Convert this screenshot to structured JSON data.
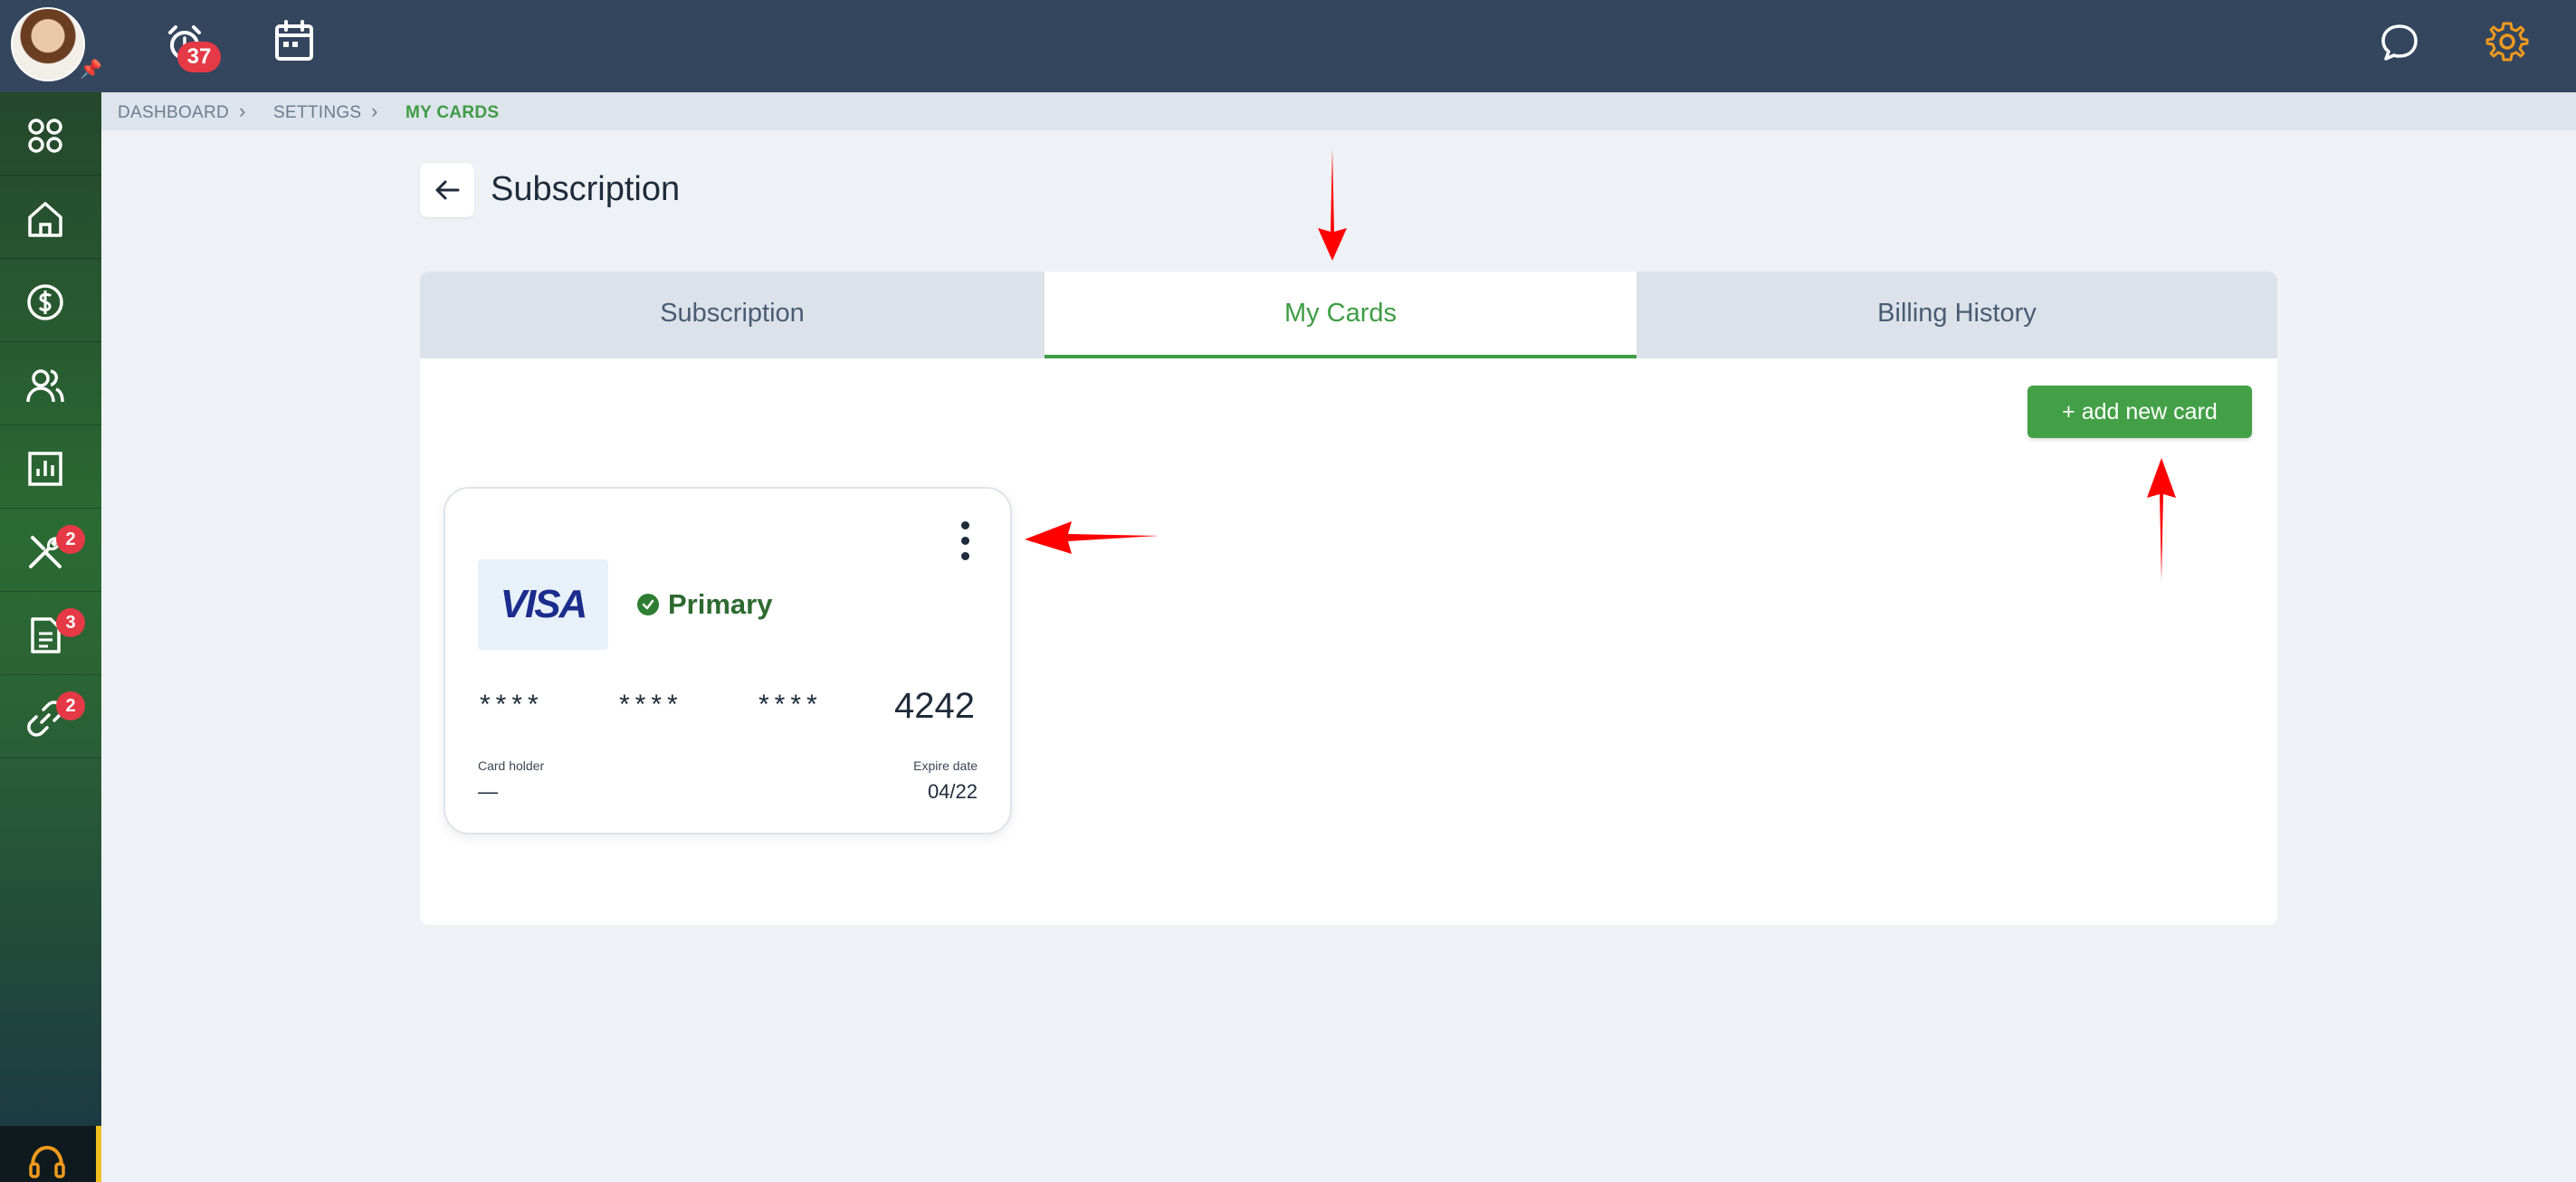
{
  "topbar": {
    "alarm_count": "37"
  },
  "sidebar": {
    "items": [
      {
        "name": "dashboard",
        "badge": ""
      },
      {
        "name": "home",
        "badge": ""
      },
      {
        "name": "billing",
        "badge": ""
      },
      {
        "name": "users",
        "badge": ""
      },
      {
        "name": "reports",
        "badge": ""
      },
      {
        "name": "tools",
        "badge": "2"
      },
      {
        "name": "documents",
        "badge": "3"
      },
      {
        "name": "integrations",
        "badge": "2"
      }
    ]
  },
  "breadcrumb": {
    "items": [
      "DASHBOARD",
      "SETTINGS",
      "MY CARDS"
    ]
  },
  "page": {
    "title": "Subscription"
  },
  "tabs": [
    {
      "label": "Subscription",
      "active": false
    },
    {
      "label": "My Cards",
      "active": true
    },
    {
      "label": "Billing History",
      "active": false
    }
  ],
  "add_card_label": "+ add new card",
  "card": {
    "brand": "VISA",
    "status": "Primary",
    "mask_groups": [
      "****",
      "****",
      "****"
    ],
    "last4": "4242",
    "holder_label": "Card holder",
    "holder_value": "—",
    "expire_label": "Expire date",
    "expire_value": "04/22"
  },
  "colors": {
    "topbar": "#34465e",
    "accent": "#3e9c44",
    "badge": "#e53946",
    "annotation": "#ff0000"
  }
}
